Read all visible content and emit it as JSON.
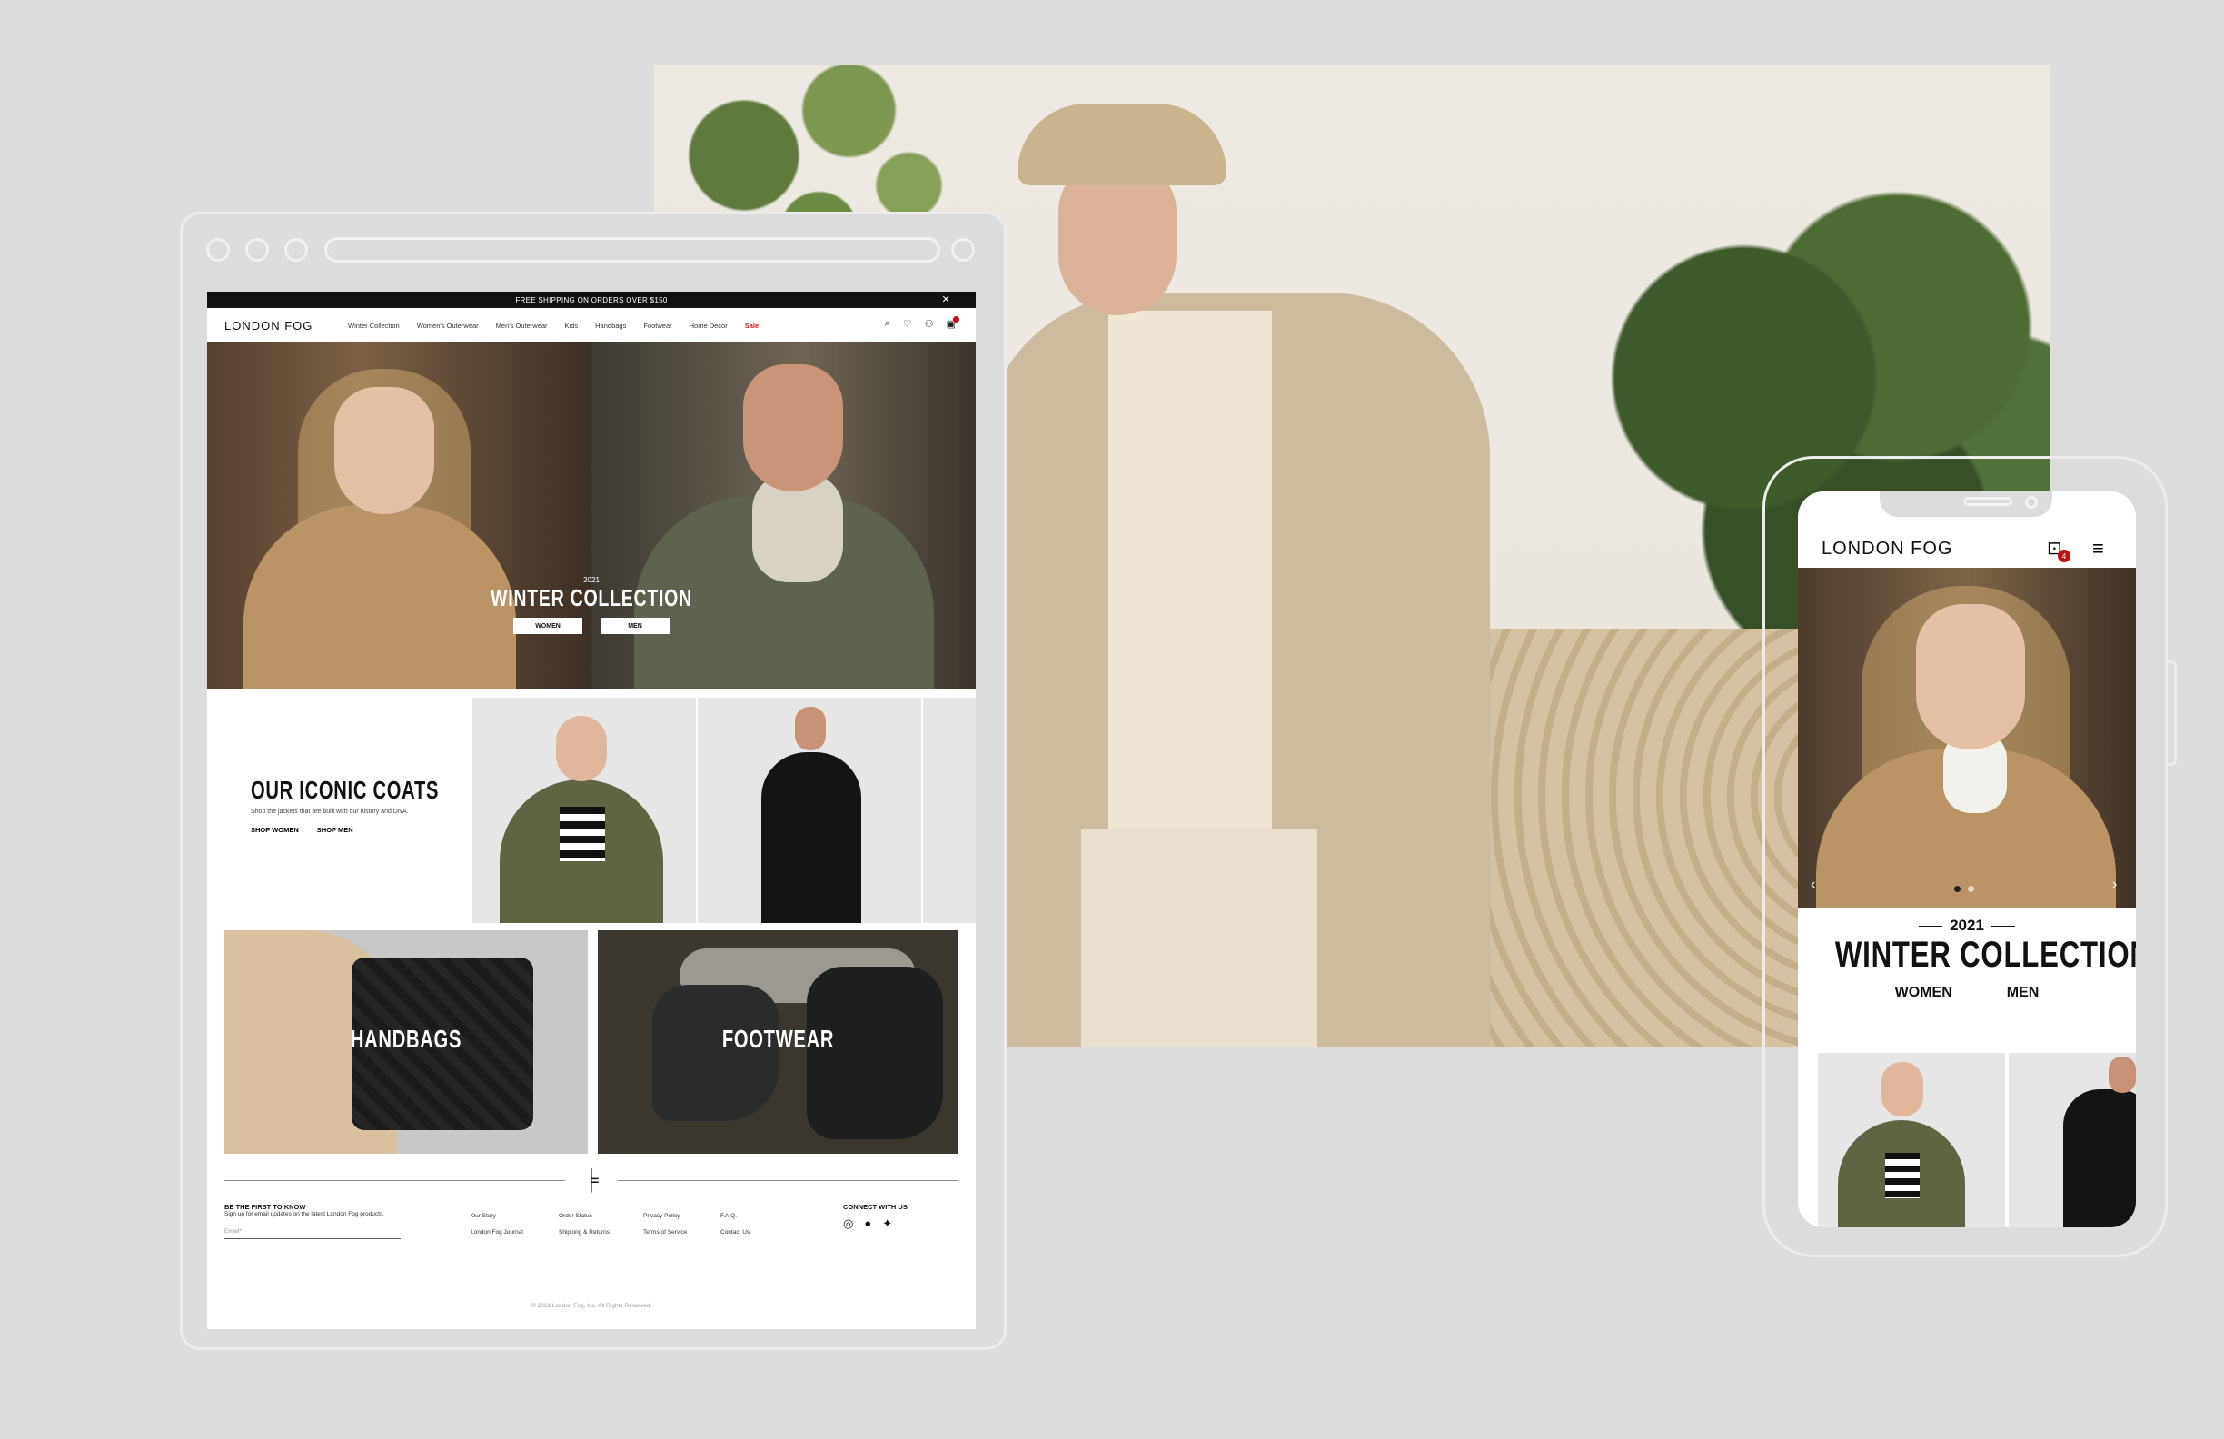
{
  "desktop": {
    "promo_text": "FREE SHIPPING ON ORDERS OVER $150",
    "promo_close": "✕",
    "logo": "LONDON FOG",
    "nav_items": [
      "Winter Collection",
      "Women's Outerwear",
      "Men's Outerwear",
      "Kids",
      "Handbags",
      "Footwear",
      "Home Decor",
      "Sale"
    ],
    "hero": {
      "year": "2021",
      "title": "WINTER COLLECTION",
      "btn_women": "WOMEN",
      "btn_men": "MEN"
    },
    "coats": {
      "title": "OUR ICONIC COATS",
      "subtitle": "Shop the jackets that are built with our history and DNA.",
      "link_women": "SHOP WOMEN",
      "link_men": "SHOP MEN"
    },
    "tiles": {
      "handbags": "HANDBAGS",
      "footwear": "FOOTWEAR"
    },
    "footer": {
      "newsletter_heading": "BE THE FIRST TO KNOW",
      "newsletter_text": "Sign up for email updates on the latest London Fog products.",
      "email_placeholder": "Email*",
      "col1": [
        "Our Story",
        "London Fog Journal"
      ],
      "col2": [
        "Order Status",
        "Shipping & Returns"
      ],
      "col3": [
        "Privacy Policy",
        "Terms of Service"
      ],
      "col4": [
        "F.A.Q.",
        "Contact Us"
      ],
      "connect_heading": "CONNECT WITH US",
      "copyright": "© 2021 London Fog, Inc. All Rights Reserved."
    }
  },
  "mobile": {
    "logo": "LONDON FOG",
    "cart_count": "4",
    "hero": {
      "year": "2021",
      "title": "WINTER COLLECTION",
      "link_women": "WOMEN",
      "link_men": "MEN"
    }
  },
  "icons": {
    "search": "search-icon",
    "wishlist": "heart-icon",
    "account": "user-icon",
    "cart": "cart-icon",
    "menu": "hamburger-icon"
  },
  "colors": {
    "sale": "#d01818",
    "badge": "#c01010",
    "promo_bg": "#111111",
    "page_bg": "#dcdcdc"
  }
}
